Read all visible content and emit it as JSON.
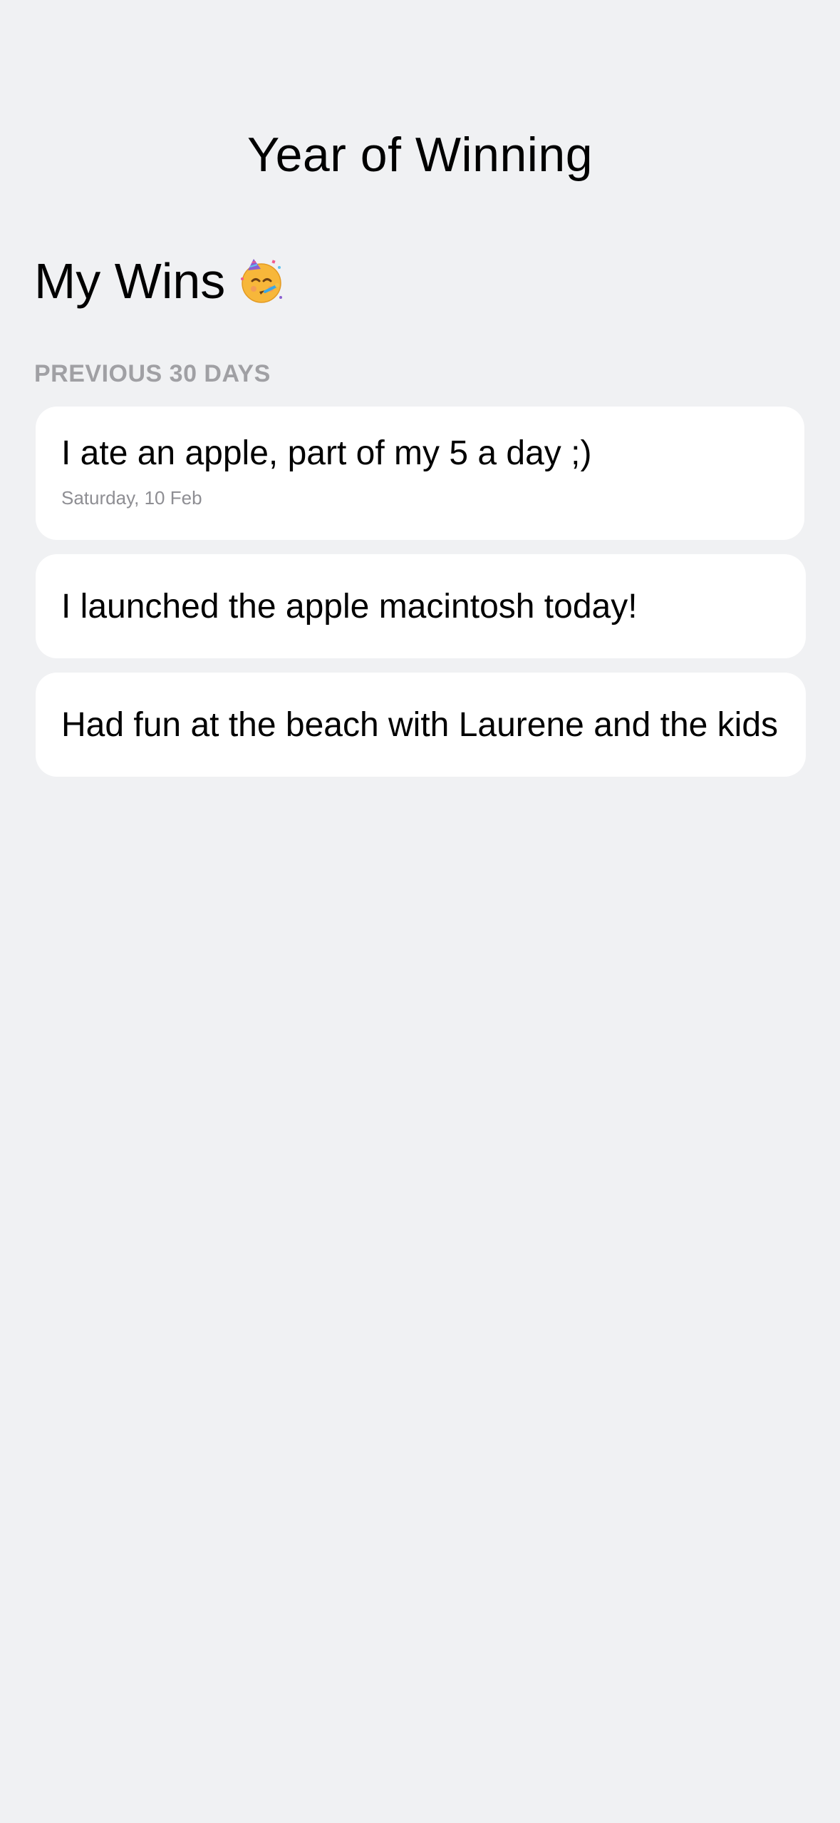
{
  "header": {
    "title": "Year of Winning"
  },
  "main": {
    "large_title": "My Wins",
    "title_icon": "partying-face-emoji",
    "section_header": "PREVIOUS 30 DAYS",
    "wins": [
      {
        "text": "I ate an apple, part of my 5 a day ;)",
        "date": "Saturday, 10 Feb"
      },
      {
        "text": "I launched the apple macintosh today!"
      },
      {
        "text": "Had fun at the beach with Laurene and the kids"
      }
    ]
  },
  "colors": {
    "background": "#f0f1f3",
    "card": "#ffffff",
    "section_header": "#a0a0a4",
    "secondary_text": "#8e8e93"
  }
}
